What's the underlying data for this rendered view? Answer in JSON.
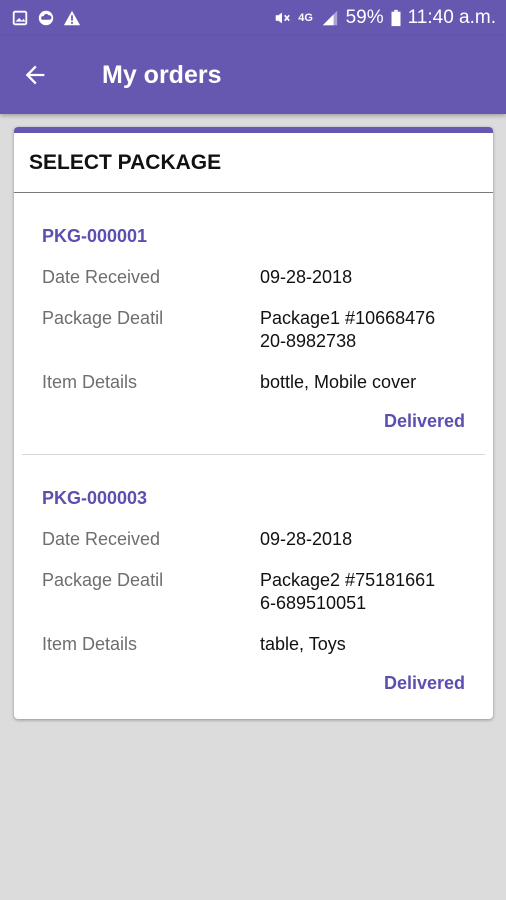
{
  "status_bar": {
    "battery": "59%",
    "time": "11:40 a.m.",
    "network": "4G",
    "left_icons": [
      "image-icon",
      "cloud-icon",
      "warning-icon"
    ],
    "right_icons": [
      "mute-icon",
      "signal-icon",
      "battery-icon"
    ]
  },
  "app_bar": {
    "title": "My orders",
    "back_icon": "arrow-back-icon",
    "color": "#6658b0"
  },
  "card": {
    "header": "SELECT PACKAGE",
    "packages": [
      {
        "id": "PKG-000001",
        "rows": [
          {
            "label": "Date Received",
            "value": "09-28-2018"
          },
          {
            "label": "Package Deatil",
            "value": "Package1 #10668476\n20-8982738"
          },
          {
            "label": "Item Details",
            "value": "bottle, Mobile cover"
          }
        ],
        "status": "Delivered"
      },
      {
        "id": "PKG-000003",
        "rows": [
          {
            "label": "Date Received",
            "value": "09-28-2018"
          },
          {
            "label": "Package Deatil",
            "value": "Package2 #75181661\n6-689510051"
          },
          {
            "label": "Item Details",
            "value": "table, Toys"
          }
        ],
        "status": "Delivered"
      }
    ]
  },
  "colors": {
    "accent": "#6658b0",
    "link": "#5b4fb0",
    "background": "#dcdcdc"
  }
}
